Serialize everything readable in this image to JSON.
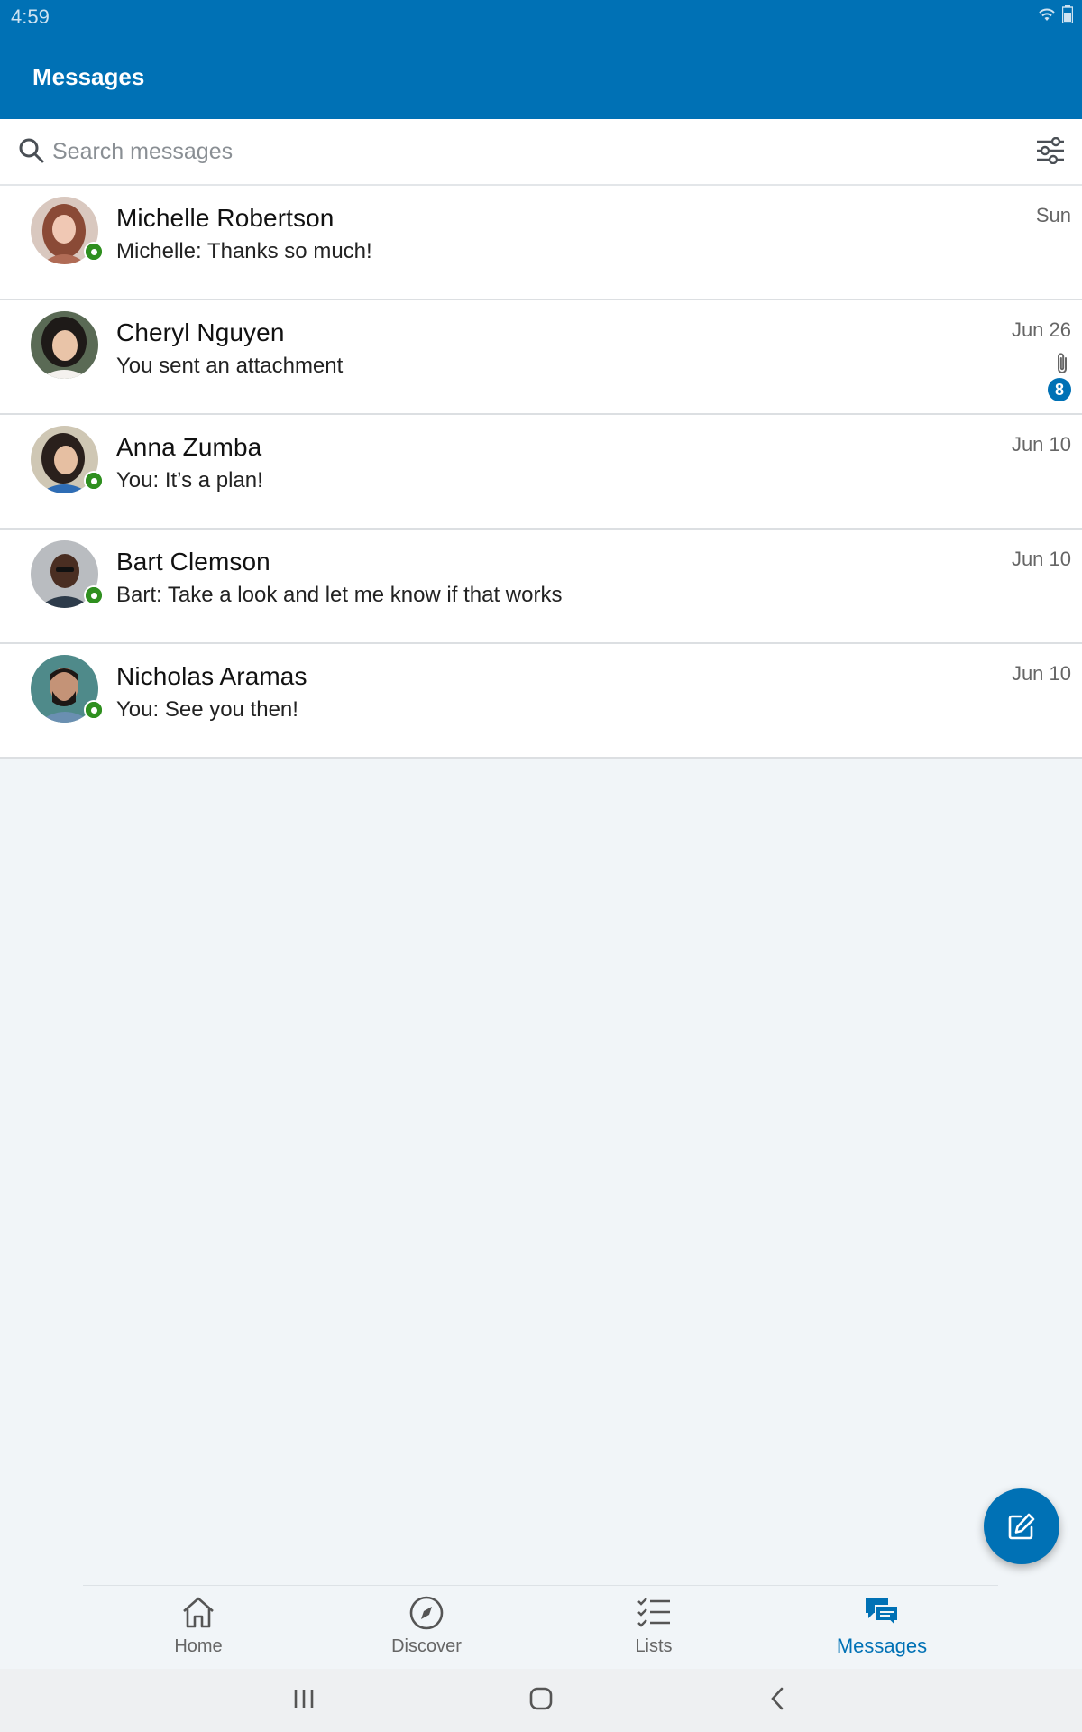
{
  "status_bar": {
    "time": "4:59"
  },
  "header": {
    "title": "Messages"
  },
  "search": {
    "placeholder": "Search messages",
    "value": ""
  },
  "conversations": [
    {
      "name": "Michelle Robertson",
      "preview": "Michelle: Thanks so much!",
      "date": "Sun",
      "online": true
    },
    {
      "name": "Cheryl Nguyen",
      "preview": "You sent an attachment",
      "date": "Jun 26",
      "online": false,
      "attachment_icon": "paperclip-icon",
      "unread": "8"
    },
    {
      "name": "Anna Zumba",
      "preview": "You: It’s a plan!",
      "date": "Jun 10",
      "online": true
    },
    {
      "name": "Bart Clemson",
      "preview": "Bart: Take a look and let me know if that works",
      "date": "Jun 10",
      "online": true
    },
    {
      "name": "Nicholas Aramas",
      "preview": "You: See you then!",
      "date": "Jun 10",
      "online": true
    }
  ],
  "fab": {
    "icon": "compose-icon"
  },
  "bottom_nav": {
    "items": [
      {
        "label": "Home",
        "icon": "home-icon"
      },
      {
        "label": "Discover",
        "icon": "compass-icon"
      },
      {
        "label": "Lists",
        "icon": "checklist-icon"
      },
      {
        "label": "Messages",
        "icon": "chat-icon",
        "active": true
      }
    ]
  },
  "colors": {
    "brand": "#0071b5",
    "presence": "#2f8f1f",
    "background": "#f1f5f8"
  }
}
